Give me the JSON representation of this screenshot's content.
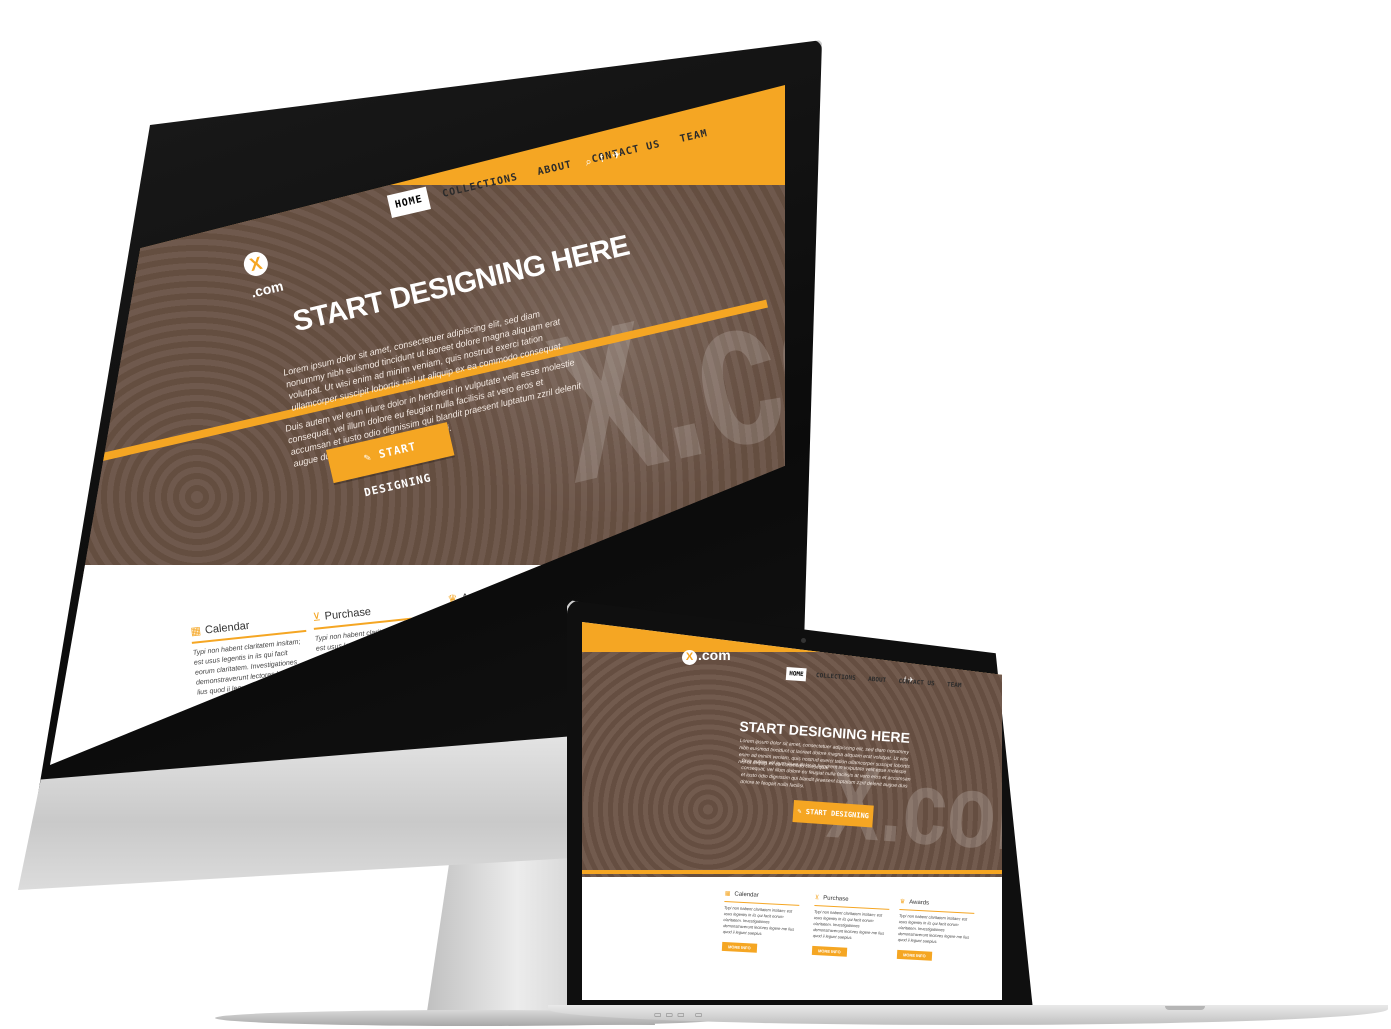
{
  "site": {
    "logo_mark": "X",
    "logo_text": ".com",
    "nav": [
      {
        "label": "HOME",
        "active": true
      },
      {
        "label": "COLLECTIONS",
        "active": false
      },
      {
        "label": "ABOUT",
        "active": false
      },
      {
        "label": "CONTACT US",
        "active": false
      },
      {
        "label": "TEAM",
        "active": false
      }
    ],
    "icons": [
      "search-icon",
      "facebook-icon",
      "twitter-icon"
    ],
    "icon_glyphs": {
      "search": "⌕",
      "facebook": "f",
      "twitter": "✈"
    },
    "hero": {
      "title": "START DESIGNING HERE",
      "paragraph1": "Lorem ipsum dolor sit amet, consectetuer adipiscing elit, sed diam nonummy nibh euismod tincidunt ut laoreet dolore magna aliquam erat volutpat. Ut wisi enim ad minim veniam, quis nostrud exerci tation ullamcorper suscipit lobortis nisl ut aliquip ex ea commodo consequat.",
      "paragraph2": "Duis autem vel eum iriure dolor in hendrerit in vulputate velit esse molestie consequat, vel illum dolore eu feugiat nulla facilisis at vero eros et accumsan et iusto odio dignissim qui blandit praesent luptatum zzril delenit augue duis dolore te feugait nulla facilisi.",
      "button": "START DESIGNING",
      "watermark": "X.com"
    },
    "features": [
      {
        "icon": "calendar-icon",
        "glyph": "▦",
        "title": "Calendar",
        "body": "Typi non habent claritatem insitam; est usus legentis in iis qui facit eorum claritatem. Investigationes demonstraverunt lectores legere me lius quod ii legunt saepius.",
        "button": "MORE INFO"
      },
      {
        "icon": "cart-icon",
        "glyph": "⊻",
        "title": "Purchase",
        "body": "Typi non habent claritatem insitam; est usus legentis in iis qui facit eorum claritatem. Investigationes demonstraverunt lectores legere me lius quod ii legunt saepius.",
        "button": "MORE INFO"
      },
      {
        "icon": "trophy-icon",
        "glyph": "♛",
        "title": "Awards",
        "body": "Typi non habent claritatem insitam; est usus legentis in iis qui facit eorum claritatem. Investigationes demonstraverunt lectores legere me lius quod ii legunt saepius.",
        "button": "MORE INFO"
      }
    ]
  },
  "colors": {
    "accent": "#f5a623",
    "hero_tint": "#7a6356"
  }
}
